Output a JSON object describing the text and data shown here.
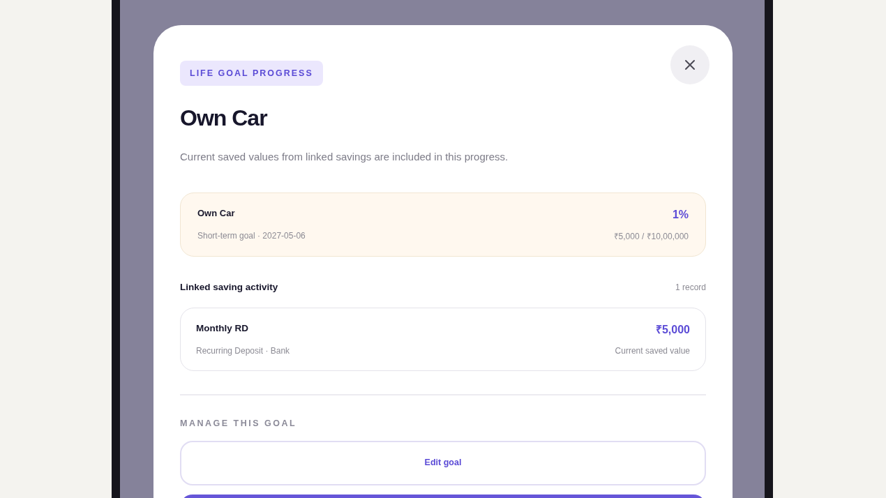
{
  "modal": {
    "badge": "LIFE GOAL PROGRESS",
    "title": "Own Car",
    "subtitle": "Current saved values from linked savings are included in this progress.",
    "goal_card": {
      "name": "Own Car",
      "meta": "Short-term goal · 2027-05-06",
      "percent": "1%",
      "amounts": "₹5,000 / ₹10,00,000"
    },
    "linked_section": {
      "title": "Linked saving activity",
      "count": "1 record",
      "records": [
        {
          "name": "Monthly RD",
          "meta": "Recurring Deposit · Bank",
          "amount": "₹5,000",
          "amount_label": "Current saved value"
        }
      ]
    },
    "manage": {
      "heading": "MANAGE THIS GOAL",
      "buttons": [
        {
          "kind": "outline",
          "label": "Edit goal"
        },
        {
          "kind": "primary"
        }
      ]
    }
  }
}
